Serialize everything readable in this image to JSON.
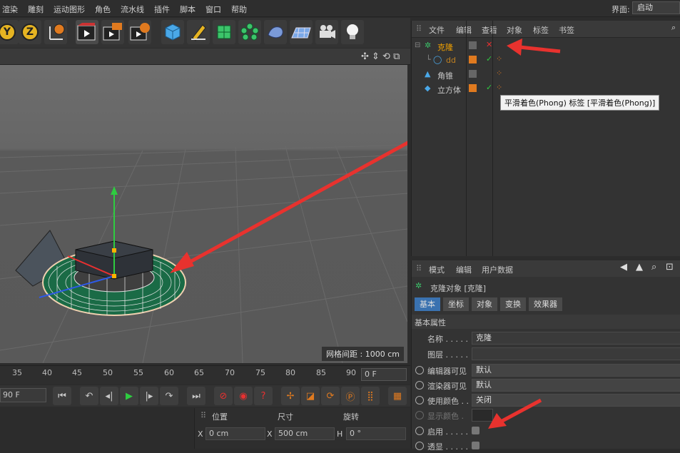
{
  "menubar": {
    "items": [
      "渲染",
      "雕刻",
      "运动图形",
      "角色",
      "流水线",
      "插件",
      "脚本",
      "窗口",
      "帮助"
    ],
    "layout_label": "界面:",
    "layout_value": "启动"
  },
  "toolbar": {
    "axis_buttons": [
      "Y",
      "Z"
    ]
  },
  "viewport": {
    "grid_spacing": "网格间距 : 1000 cm"
  },
  "timeline": {
    "ticks": [
      "35",
      "40",
      "45",
      "50",
      "55",
      "60",
      "65",
      "70",
      "75",
      "80",
      "85",
      "90"
    ],
    "current_frame": "0 F",
    "end_frame": "90 F"
  },
  "coordinates": {
    "headers": [
      "位置",
      "尺寸",
      "旋转"
    ],
    "x_label": "X",
    "x_position": "0 cm",
    "x_size_label": "X",
    "x_size": "500 cm",
    "h_label": "H",
    "h_rotation": "0 °"
  },
  "object_manager": {
    "menu": [
      "文件",
      "编辑",
      "查看",
      "对象",
      "标签",
      "书签"
    ],
    "objects": [
      {
        "name": "克隆",
        "color": "#f0a000"
      },
      {
        "name": "dd",
        "color": "#c08020"
      },
      {
        "name": "角锥",
        "color": "#c8c8c8"
      },
      {
        "name": "立方体",
        "color": "#c8c8c8"
      }
    ],
    "tooltip": "平滑着色(Phong) 标签 [平滑着色(Phong)]"
  },
  "attribute_manager": {
    "menu": [
      "模式",
      "编辑",
      "用户数据"
    ],
    "title": "克隆对象 [克隆]",
    "tabs": [
      "基本",
      "坐标",
      "对象",
      "变换",
      "效果器"
    ],
    "section": "基本属性",
    "properties": [
      {
        "label": "名称 . . . . .",
        "value": "克隆"
      },
      {
        "label": "图层 . . . . .",
        "value": ""
      },
      {
        "label": "编辑器可见",
        "value": "默认"
      },
      {
        "label": "渲染器可见",
        "value": "默认"
      },
      {
        "label": "使用颜色 . .",
        "value": "关闭"
      },
      {
        "label": "显示颜色 .",
        "value": ""
      },
      {
        "label": "启用 . . . . .",
        "value": ""
      },
      {
        "label": "透显 . . . . .",
        "value": ""
      }
    ]
  },
  "colors": {
    "accent_orange": "#e07a1f",
    "selected_tab": "#3a72b0",
    "arrow_red": "#e8322e"
  }
}
